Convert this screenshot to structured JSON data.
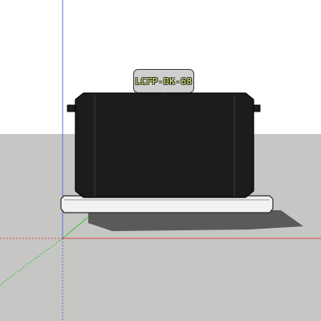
{
  "scene": {
    "sky_color": "#ffffff",
    "ground_color": "#c6c6c4",
    "axis_colors": {
      "blue": "#5b6fd6",
      "green": "#33c733",
      "red": "#d84a4a"
    }
  },
  "model": {
    "component_tag": "LCFP-DK-68"
  }
}
